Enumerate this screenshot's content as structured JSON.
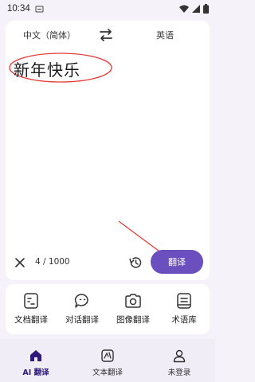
{
  "status": {
    "time": "10:34"
  },
  "languages": {
    "source": "中文（简体）",
    "target": "英语"
  },
  "input": {
    "text": "新年快乐",
    "count": "4 / 1000"
  },
  "actions": {
    "translate_label": "翻译"
  },
  "tools": [
    {
      "label": "文档翻译",
      "icon": "document-icon"
    },
    {
      "label": "对话翻译",
      "icon": "chat-icon"
    },
    {
      "label": "图像翻译",
      "icon": "camera-icon"
    },
    {
      "label": "术语库",
      "icon": "glossary-icon"
    }
  ],
  "nav": [
    {
      "label": "AI 翻译",
      "icon": "home-icon",
      "active": true
    },
    {
      "label": "文本翻译",
      "icon": "text-translate-icon",
      "active": false
    },
    {
      "label": "未登录",
      "icon": "user-icon",
      "active": false
    }
  ],
  "colors": {
    "accent": "#6b4fbf",
    "annotation": "#e53935"
  }
}
